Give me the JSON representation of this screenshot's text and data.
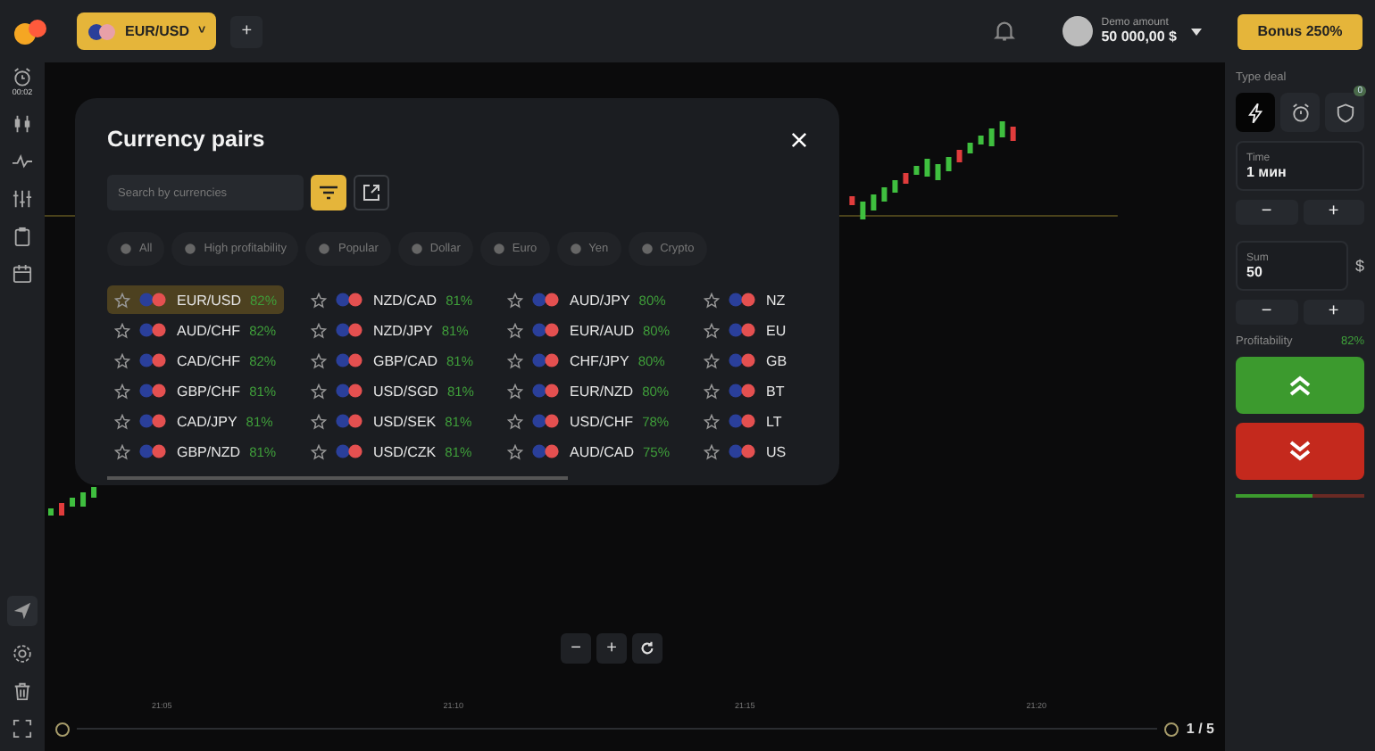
{
  "topbar": {
    "pair": "EUR/USD",
    "caret": "˅",
    "add": "+",
    "account_label": "Demo amount",
    "account_balance": "50 000,00 $",
    "bonus": "Bonus 250%"
  },
  "left_sidebar": {
    "timer": "00:02"
  },
  "chart": {
    "time_labels": [
      "21:05",
      "21:10",
      "21:15",
      "21:20"
    ],
    "zoom_out": "−",
    "zoom_in": "+",
    "page": "1 / 5"
  },
  "modal": {
    "title": "Currency pairs",
    "search": {
      "placeholder": "Search by currencies"
    },
    "filters": [
      {
        "label": "All"
      },
      {
        "label": "High profitability"
      },
      {
        "label": "Popular"
      },
      {
        "label": "Dollar"
      },
      {
        "label": "Euro"
      },
      {
        "label": "Yen"
      },
      {
        "label": "Crypto"
      }
    ],
    "columns": [
      [
        {
          "pair": "EUR/USD",
          "profit": "82%",
          "selected": true
        },
        {
          "pair": "AUD/CHF",
          "profit": "82%",
          "selected": false
        },
        {
          "pair": "CAD/CHF",
          "profit": "82%",
          "selected": false
        },
        {
          "pair": "GBP/CHF",
          "profit": "81%",
          "selected": false
        },
        {
          "pair": "CAD/JPY",
          "profit": "81%",
          "selected": false
        },
        {
          "pair": "GBP/NZD",
          "profit": "81%",
          "selected": false
        }
      ],
      [
        {
          "pair": "NZD/CAD",
          "profit": "81%",
          "selected": false
        },
        {
          "pair": "NZD/JPY",
          "profit": "81%",
          "selected": false
        },
        {
          "pair": "GBP/CAD",
          "profit": "81%",
          "selected": false
        },
        {
          "pair": "USD/SGD",
          "profit": "81%",
          "selected": false
        },
        {
          "pair": "USD/SEK",
          "profit": "81%",
          "selected": false
        },
        {
          "pair": "USD/CZK",
          "profit": "81%",
          "selected": false
        }
      ],
      [
        {
          "pair": "AUD/JPY",
          "profit": "80%",
          "selected": false
        },
        {
          "pair": "EUR/AUD",
          "profit": "80%",
          "selected": false
        },
        {
          "pair": "CHF/JPY",
          "profit": "80%",
          "selected": false
        },
        {
          "pair": "EUR/NZD",
          "profit": "80%",
          "selected": false
        },
        {
          "pair": "USD/CHF",
          "profit": "78%",
          "selected": false
        },
        {
          "pair": "AUD/CAD",
          "profit": "75%",
          "selected": false
        }
      ],
      [
        {
          "pair": "NZ",
          "selected": false
        },
        {
          "pair": "EU",
          "selected": false
        },
        {
          "pair": "GB",
          "selected": false
        },
        {
          "pair": "BT",
          "selected": false
        },
        {
          "pair": "LT",
          "selected": false
        },
        {
          "pair": "US",
          "selected": false
        }
      ]
    ]
  },
  "deal_panel": {
    "type_label": "Type deal",
    "types": [
      {
        "kind": "flash",
        "selected": true
      },
      {
        "kind": "timer",
        "selected": false
      },
      {
        "kind": "shield",
        "selected": false,
        "badge": "0"
      }
    ],
    "time_label": "Time",
    "time_value": "1 мин",
    "minus": "−",
    "plus": "+",
    "sum_label": "Sum",
    "sum_value": "50",
    "currency": "$",
    "profit_label": "Profitability",
    "profit_value": "82%",
    "sentiment": {
      "level": 0.6
    }
  }
}
